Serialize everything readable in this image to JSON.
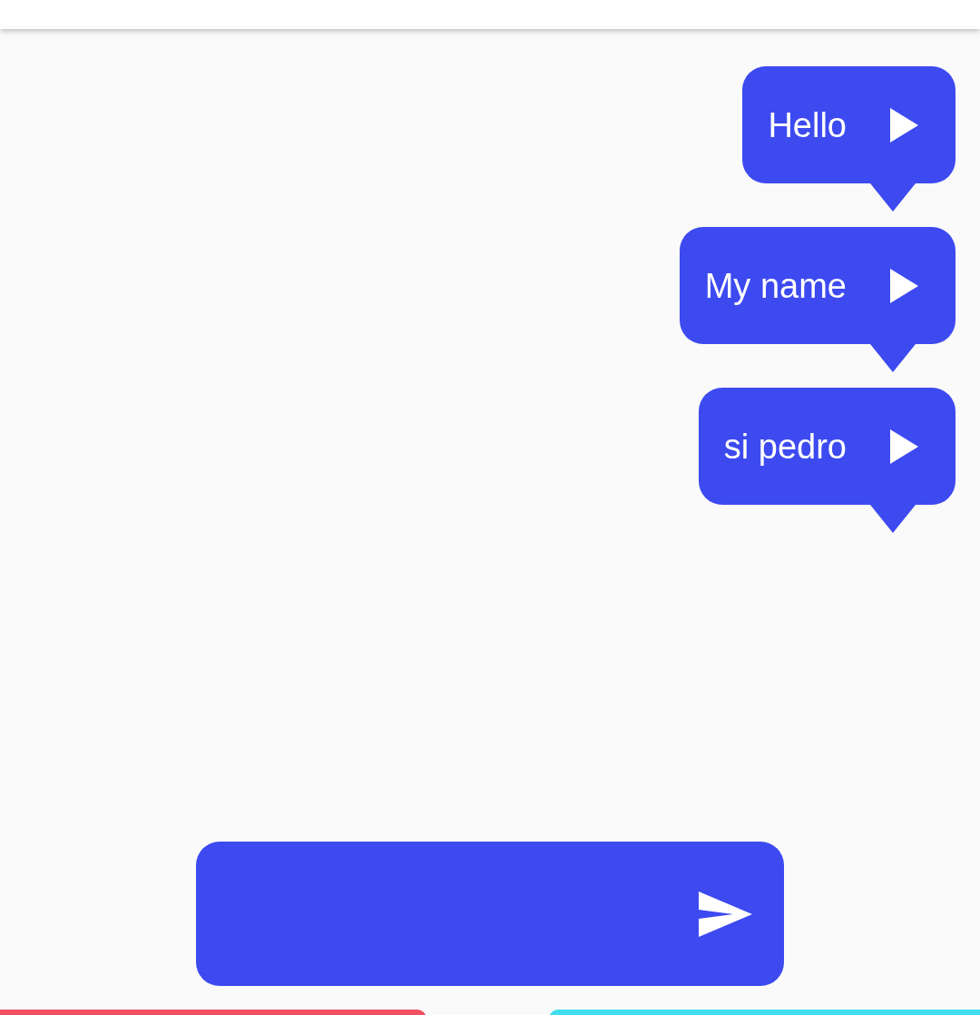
{
  "messages": [
    {
      "text": "Hello"
    },
    {
      "text": "My name"
    },
    {
      "text": "si pedro"
    }
  ]
}
